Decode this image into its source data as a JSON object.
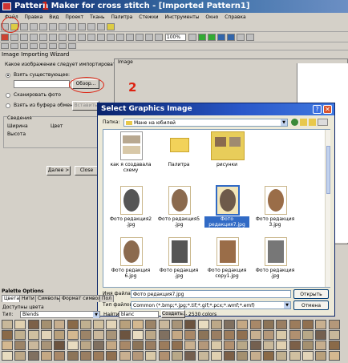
{
  "window": {
    "title": "Pattern Maker for cross stitch - [Imported Pattern1]"
  },
  "menu": [
    "Файл",
    "Правка",
    "Вид",
    "Проект",
    "Ткань",
    "Палитра",
    "Стежки",
    "Инструменты",
    "Окно",
    "Справка"
  ],
  "toolbar": {
    "zoom": "100%"
  },
  "wizard": {
    "title": "Image Importing Wizard",
    "question": "Какое изображение следует импортировать?",
    "option_existing": "Взять существующее:",
    "browse_label": "Обзор...",
    "option_scan": "Сканировать фото",
    "option_clipboard": "Взять из буфера обмена:",
    "clipboard_btn": "Вставить",
    "info_title": "Сведения",
    "info_width": "Ширина",
    "info_color": "Цвет",
    "info_height": "Высота",
    "next_btn": "Далее >",
    "close_btn": "Close"
  },
  "image_panel": {
    "label": "Image"
  },
  "dialog": {
    "title": "Select Graphics Image",
    "folder_label": "Папка:",
    "folder_value": "Мане на юбилей",
    "files": [
      {
        "name": "как я создавала схему",
        "kind": "doc"
      },
      {
        "name": "Палитра",
        "kind": "folder"
      },
      {
        "name": "рисунки",
        "kind": "doc2"
      },
      {
        "name": "Фото редакция2 .jpg",
        "kind": "oval"
      },
      {
        "name": "Фото редакция5 .jpg",
        "kind": "oval"
      },
      {
        "name": "Фото редакция7.jpg",
        "kind": "oval",
        "selected": true
      },
      {
        "name": "Фото редакция 3.jpg",
        "kind": "oval"
      },
      {
        "name": "Фото редакция 6.jpg",
        "kind": "oval"
      },
      {
        "name": "Фото редакция .jpg",
        "kind": "bw"
      },
      {
        "name": "Фото редакция copy1.jpg",
        "kind": "sepia"
      },
      {
        "name": "Фото редакция .jpg",
        "kind": "bw2"
      }
    ],
    "filename_label": "Имя файла:",
    "filename_value": "Фото редакция7.jpg",
    "filetype_label": "Тип файлов:",
    "filetype_value": "Common (*.bmp;*.jpg;*.tif;*.gif;*.pcx;*.wmf;*.emf)",
    "open_btn": "Открыть",
    "cancel_btn": "Отмена"
  },
  "palette": {
    "title": "Palette Options",
    "tabs": [
      "Цвета",
      "Нити",
      "Символы",
      "Формат символа",
      "Пол"
    ],
    "available_label": "Доступны цвета",
    "type_label": "Тип:",
    "type_value": "Blends",
    "find_label": "Найти:",
    "find_value": "blanc",
    "create_btn": "Создать...",
    "count_text": "2530 colors"
  },
  "swatch_colors": [
    "#c8b89a",
    "#a89478",
    "#d9c9a8",
    "#b8a07c",
    "#9c7c5c",
    "#8a6a48",
    "#c4a884",
    "#e0d0b0",
    "#6c5440",
    "#b09070",
    "#d4b890",
    "#907050",
    "#c0b090",
    "#a88868",
    "#7c6048",
    "#e8dcc0",
    "#b8a888",
    "#9c8468",
    "#c8b090",
    "#d0c0a0",
    "#8c7458",
    "#a49070",
    "#bca888",
    "#746050",
    "#cab89c",
    "#b4987a",
    "#e2d4b8",
    "#9a7e62",
    "#c6ae8e",
    "#807060"
  ],
  "annotations": {
    "step1": "1",
    "step2": "2"
  }
}
